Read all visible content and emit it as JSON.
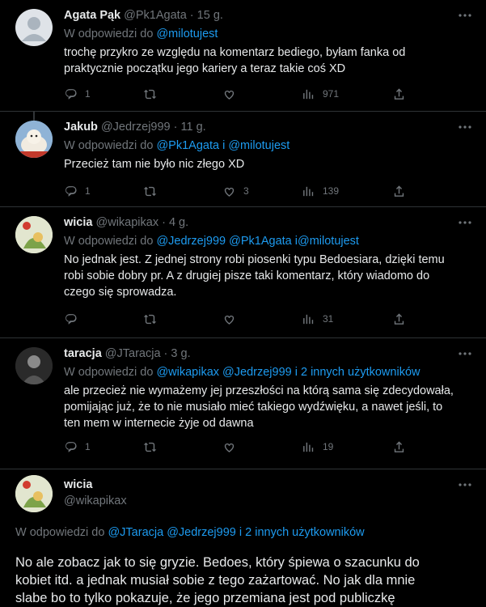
{
  "replying_prefix": "W odpowiedzi do",
  "replies": [
    {
      "name": "Agata Pąk",
      "handle": "@Pk1Agata",
      "time": "15 g.",
      "replying_to": "@milotujest",
      "text_lines": [
        "trochę przykro ze względu na komentarz bediego, byłam fanka od",
        "praktycznie początku jego kariery a teraz takie coś XD"
      ],
      "replies": "1",
      "retweets": "",
      "likes": "",
      "views": "971"
    },
    {
      "name": "Jakub",
      "handle": "@Jedrzej999",
      "time": "11 g.",
      "replying_to": "@Pk1Agata i @milotujest",
      "text_lines": [
        "Przecież tam nie było nic złego XD"
      ],
      "replies": "1",
      "retweets": "",
      "likes": "3",
      "views": "139"
    },
    {
      "name": "wicia",
      "handle": "@wikapikax",
      "time": "4 g.",
      "replying_to": "@Jedrzej999 @Pk1Agata i@milotujest",
      "text_lines": [
        "No jednak jest. Z jednej strony robi piosenki typu Bedoesiara, dzięki temu",
        "robi sobie dobry pr. A z drugiej pisze taki komentarz, który wiadomo do",
        "czego się sprowadza."
      ],
      "replies": "",
      "retweets": "",
      "likes": "",
      "views": "31"
    },
    {
      "name": "taracja",
      "handle": "@JTaracja",
      "time": "3 g.",
      "replying_to": "@wikapikax @Jedrzej999  i 2 innych użytkowników",
      "text_lines": [
        "ale przecież nie wymażemy jej przeszłości na którą sama się zdecydowała,",
        "pomijając już, że to nie musiało mieć takiego wydźwięku, a nawet jeśli, to",
        "ten mem w internecie żyje od dawna"
      ],
      "replies": "1",
      "retweets": "",
      "likes": "",
      "views": "19"
    }
  ],
  "main": {
    "name": "wicia",
    "handle": "@wikapikax",
    "replying_to": "@JTaracja @Jedrzej999  i 2 innych użytkowników",
    "text_lines": [
      "No ale zobacz jak to się gryzie. Bedoes, który śpiewa o szacunku do",
      "kobiet itd. a jednak musiał sobie z tego zażartować. No jak dla mnie",
      "slabe bo to tylko pokazuje, że jego przemiana jest pod publiczkę"
    ]
  },
  "icons": [
    "more-icon",
    "reply-icon",
    "retweet-icon",
    "like-icon",
    "views-icon",
    "share-icon"
  ],
  "colors": {
    "background": "#000000",
    "text": "#e7e9ea",
    "muted": "#71767b",
    "link": "#1d9bf0",
    "divider": "#2f3336"
  }
}
